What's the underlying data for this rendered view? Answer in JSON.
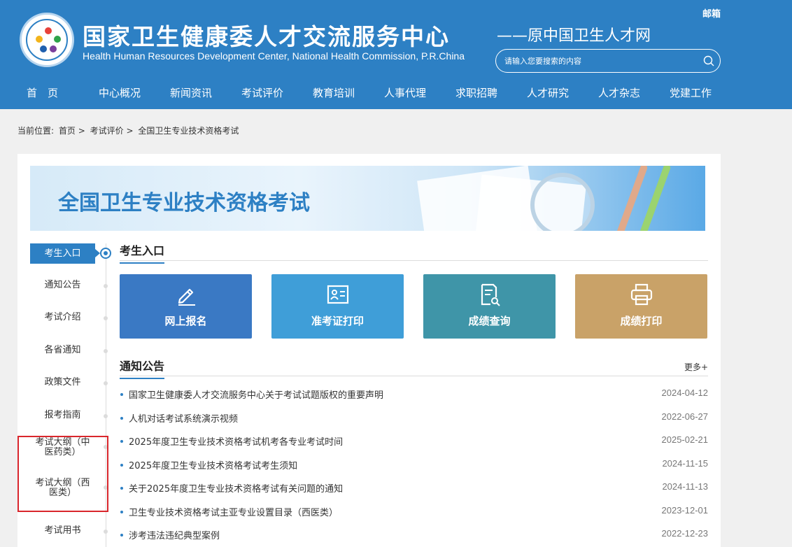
{
  "header": {
    "title": "国家卫生健康委人才交流服务中心",
    "subtitle": "Health Human Resources Development Center, National Health Commission, P.R.China",
    "alias": "——原中国卫生人才网",
    "mailbox": "邮箱",
    "search_placeholder": "请输入您要搜索的内容"
  },
  "nav": [
    "首　页",
    "中心概况",
    "新闻资讯",
    "考试评价",
    "教育培训",
    "人事代理",
    "求职招聘",
    "人才研究",
    "人才杂志",
    "党建工作"
  ],
  "breadcrumb": {
    "label": "当前位置:",
    "items": [
      "首页",
      ">",
      "考试评价",
      ">",
      "全国卫生专业技术资格考试"
    ]
  },
  "banner": {
    "title": "全国卫生专业技术资格考试"
  },
  "sidebar": {
    "active": "考生入口",
    "items": [
      "通知公告",
      "考试介绍",
      "各省通知",
      "政策文件",
      "报考指南",
      "考试大纲（中医药类）",
      "考试大纲（西医类）",
      "考试用书"
    ]
  },
  "entrance": {
    "heading": "考生入口",
    "tiles": [
      {
        "label": "网上报名",
        "color": "#3a79c4",
        "icon": "pencil-icon"
      },
      {
        "label": "准考证打印",
        "color": "#3f9ed8",
        "icon": "id-card-icon"
      },
      {
        "label": "成绩查询",
        "color": "#3f95a8",
        "icon": "document-search-icon"
      },
      {
        "label": "成绩打印",
        "color": "#c9a268",
        "icon": "printer-icon"
      }
    ]
  },
  "notices": {
    "heading": "通知公告",
    "more": "更多+",
    "items": [
      {
        "title": "国家卫生健康委人才交流服务中心关于考试试题版权的重要声明",
        "date": "2024-04-12"
      },
      {
        "title": "人机对话考试系统演示视频",
        "date": "2022-06-27"
      },
      {
        "title": "2025年度卫生专业技术资格考试机考各专业考试时间",
        "date": "2025-02-21"
      },
      {
        "title": "2025年度卫生专业技术资格考试考生须知",
        "date": "2024-11-15"
      },
      {
        "title": "关于2025年度卫生专业技术资格考试有关问题的通知",
        "date": "2024-11-13"
      },
      {
        "title": "卫生专业技术资格考试主亚专业设置目录（西医类）",
        "date": "2023-12-01"
      },
      {
        "title": "涉考违法违纪典型案例",
        "date": "2022-12-23"
      }
    ]
  }
}
